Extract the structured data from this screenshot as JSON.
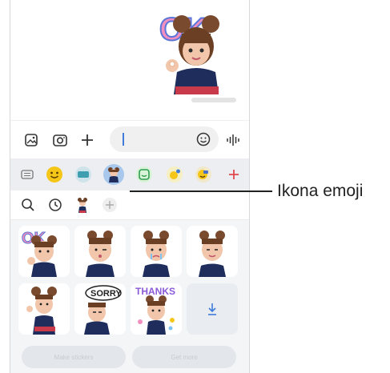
{
  "chat": {
    "sticker_text": "OK",
    "message_time": "1:30 PM"
  },
  "compose": {
    "icons": [
      "gallery-icon",
      "camera-icon",
      "plus-icon",
      "emoji-icon",
      "voice-icon"
    ]
  },
  "tray": {
    "tabs": [
      "keyboard",
      "emoji",
      "gif",
      "ar-emoji",
      "sticker",
      "emoji-stickers",
      "bitmoji",
      "add"
    ],
    "selected_tab": "ar-emoji",
    "sub_icons": [
      "search-icon",
      "recent-icon",
      "ar-emoji-avatar-icon",
      "add-icon"
    ],
    "stickers": [
      "OK",
      "",
      "",
      "",
      "",
      "SORRY",
      "THANKS"
    ],
    "buttons": {
      "make": "Make stickers",
      "more": "Get more"
    }
  },
  "callout": {
    "label": "Ikona emoji"
  },
  "colors": {
    "accent": "#3f7bd9",
    "selected_tab": "#a7c8ec",
    "callout": "#222222",
    "add_red": "#e0484e"
  }
}
